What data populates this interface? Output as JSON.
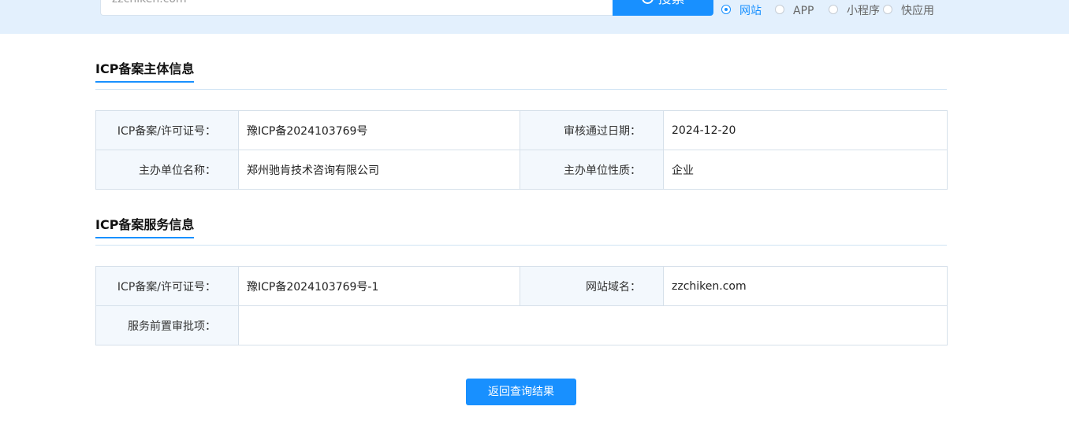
{
  "search": {
    "value": "zzchiken.com",
    "button_label": "搜索"
  },
  "type_filter": {
    "options": [
      {
        "label": "网站",
        "checked": true
      },
      {
        "label": "APP",
        "checked": false
      },
      {
        "label": "小程序",
        "checked": false
      },
      {
        "label": "快应用",
        "checked": false
      }
    ]
  },
  "subject_info": {
    "title": "ICP备案主体信息",
    "rows": [
      {
        "label1": "ICP备案/许可证号：",
        "value1": "豫ICP备2024103769号",
        "label2": "审核通过日期：",
        "value2": "2024-12-20"
      },
      {
        "label1": "主办单位名称：",
        "value1": "郑州驰肯技术咨询有限公司",
        "label2": "主办单位性质：",
        "value2": "企业"
      }
    ]
  },
  "service_info": {
    "title": "ICP备案服务信息",
    "license_label": "ICP备案/许可证号：",
    "license_value": "豫ICP备2024103769号-1",
    "domain_label": "网站域名：",
    "domain_value": "zzchiken.com",
    "approval_label": "服务前置审批项：",
    "approval_value": ""
  },
  "back_button_label": "返回查询结果",
  "colors": {
    "accent": "#1890ff",
    "topbar": "#e3f0fd",
    "label_bg": "#f3f8fd"
  }
}
